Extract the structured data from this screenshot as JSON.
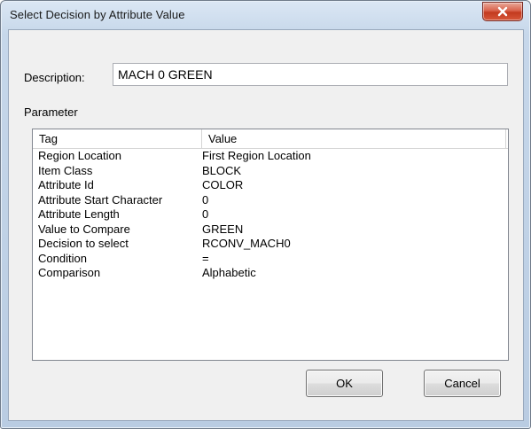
{
  "window": {
    "title": "Select Decision by  Attribute Value"
  },
  "description": {
    "label": "Description:",
    "value": "MACH 0 GREEN"
  },
  "parameter": {
    "label": "Parameter",
    "columns": [
      "Tag",
      "Value"
    ],
    "rows": [
      {
        "tag": "Region Location",
        "value": "First Region Location"
      },
      {
        "tag": "Item Class",
        "value": "BLOCK"
      },
      {
        "tag": "Attribute Id",
        "value": "COLOR"
      },
      {
        "tag": "Attribute Start Character",
        "value": "0"
      },
      {
        "tag": "Attribute Length",
        "value": "0"
      },
      {
        "tag": "Value to Compare",
        "value": "GREEN"
      },
      {
        "tag": "Decision to select",
        "value": "RCONV_MACH0"
      },
      {
        "tag": "Condition",
        "value": "="
      },
      {
        "tag": "Comparison",
        "value": "Alphabetic"
      }
    ]
  },
  "buttons": {
    "ok": "OK",
    "cancel": "Cancel"
  },
  "icons": {
    "close": "close-icon"
  },
  "colors": {
    "close_button": "#c9472b",
    "client_background": "#f0f0f0",
    "frame": "#c6d7ea"
  }
}
